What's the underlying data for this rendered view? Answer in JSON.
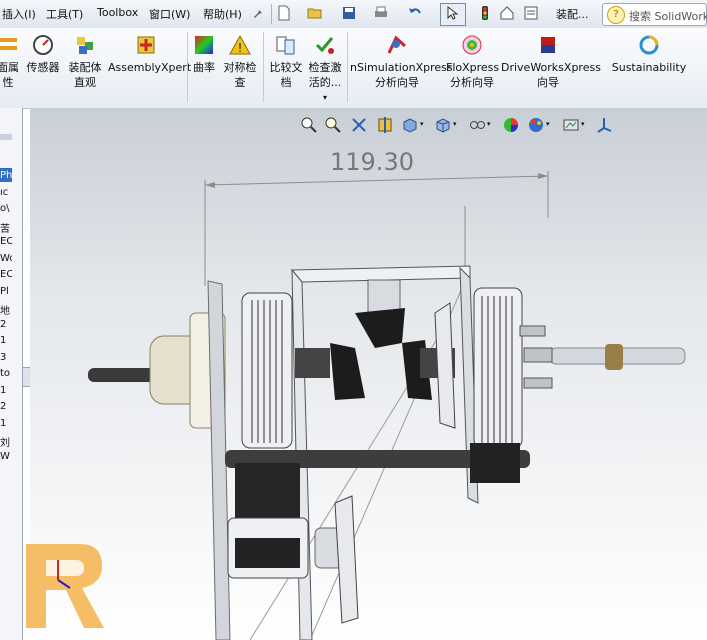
{
  "menubar": {
    "items": [
      "插入(I)",
      "工具(T)",
      "Toolbox",
      "窗口(W)",
      "帮助(H)"
    ],
    "assembly_label": "装配...",
    "search_label": "搜索 SolidWorks"
  },
  "commands": [
    {
      "label1": "面属",
      "label2": "性",
      "icon": "properties-icon"
    },
    {
      "label1": "传感器",
      "label2": "",
      "icon": "sensor-icon"
    },
    {
      "label1": "装配体",
      "label2": "直观",
      "icon": "assembly-visualization-icon"
    },
    {
      "label1": "AssemblyXpert",
      "label2": "",
      "icon": "assemblyxpert-icon"
    },
    {
      "label1": "曲率",
      "label2": "",
      "icon": "curvature-icon"
    },
    {
      "label1": "对称检",
      "label2": "查",
      "icon": "symmetry-check-icon"
    },
    {
      "label1": "比较文",
      "label2": "档",
      "icon": "compare-documents-icon"
    },
    {
      "label1": "检查激",
      "label2": "活的...",
      "icon": "check-active-icon"
    },
    {
      "label1": "nSimulationXpress",
      "label2": "分析向导",
      "icon": "simulationxpress-icon"
    },
    {
      "label1": "FloXpress",
      "label2": "分析向导",
      "icon": "floxpress-icon"
    },
    {
      "label1": "DriveWorksXpress",
      "label2": "向导",
      "icon": "driveworksxpress-icon"
    },
    {
      "label1": "Sustainability",
      "label2": "",
      "icon": "sustainability-icon"
    }
  ],
  "leftpanel": {
    "lines": [
      "Ph",
      "ıc",
      "o\\",
      "苦",
      "EC",
      "Wo",
      "EC",
      "Pl",
      "地",
      "2",
      "1",
      "3",
      "to",
      "1",
      "2",
      "1",
      "刘",
      "W"
    ]
  },
  "viewport": {
    "dimension_value": "119.30"
  },
  "colors": {
    "background_top": "#c9cfd6",
    "background_bottom": "#ffffff",
    "dimension_text": "#777777",
    "steel": "#8a9099"
  }
}
